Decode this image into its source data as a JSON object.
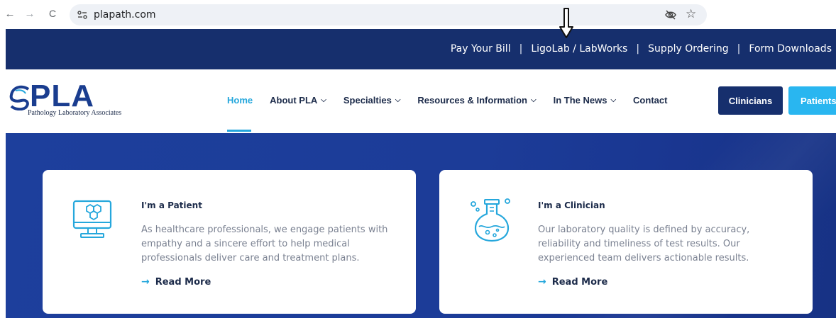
{
  "browser": {
    "url": "plapath.com",
    "back_glyph": "←",
    "forward_glyph": "→",
    "reload_glyph": "C",
    "star_glyph": "☆",
    "icons": [
      "back-arrow-icon",
      "forward-arrow-icon",
      "reload-icon",
      "site-info-icon",
      "eye-off-icon",
      "star-icon"
    ]
  },
  "utility_nav": {
    "links": [
      "Pay Your Bill",
      "LigoLab / LabWorks",
      "Supply Ordering",
      "Form Downloads"
    ],
    "separator": "|"
  },
  "logo": {
    "wordmark": "PLA",
    "tagline": "Pathology Laboratory Associates"
  },
  "main_nav": {
    "items": [
      {
        "label": "Home",
        "has_dropdown": false,
        "active": true
      },
      {
        "label": "About PLA",
        "has_dropdown": true
      },
      {
        "label": "Specialties",
        "has_dropdown": true
      },
      {
        "label": "Resources & Information",
        "has_dropdown": true
      },
      {
        "label": "In The News",
        "has_dropdown": true
      },
      {
        "label": "Contact",
        "has_dropdown": false
      }
    ],
    "chevron_glyph": "⌄"
  },
  "header_buttons": {
    "clinicians": "Clinicians",
    "patients": "Patients"
  },
  "cards": [
    {
      "title": "I'm a Patient",
      "body": "As healthcare professionals, we engage patients with empathy and a sincere effort to help medical professionals deliver care and treatment plans.",
      "link": "Read More",
      "icon": "monitor-hexagons-icon"
    },
    {
      "title": "I'm a Clinician",
      "body": "Our laboratory quality is defined by accuracy, reliability and timeliness of test results. Our experienced team delivers actionable results.",
      "link": "Read More",
      "icon": "flask-icon"
    }
  ],
  "link_arrow_glyph": "→",
  "colors": {
    "navy": "#162f6d",
    "accent_blue": "#25a7dc",
    "patients_button": "#29b6f0",
    "hero": "#1d3f9c",
    "text_dark": "#1c2b4a",
    "text_muted": "#7a8191"
  }
}
